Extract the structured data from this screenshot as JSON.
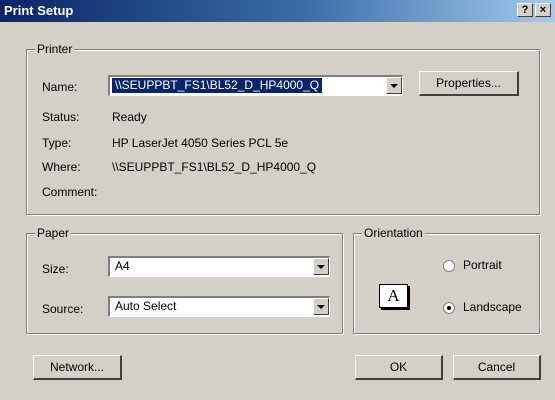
{
  "window": {
    "title": "Print Setup",
    "help_button": "?",
    "close_button": "×"
  },
  "printer": {
    "group_label": "Printer",
    "name_label": "Name:",
    "name_value": "\\\\SEUPPBT_FS1\\BL52_D_HP4000_Q",
    "properties_button": "Properties...",
    "status_label": "Status:",
    "status_value": "Ready",
    "type_label": "Type:",
    "type_value": "HP LaserJet 4050 Series PCL 5e",
    "where_label": "Where:",
    "where_value": "\\\\SEUPPBT_FS1\\BL52_D_HP4000_Q",
    "comment_label": "Comment:",
    "comment_value": ""
  },
  "paper": {
    "group_label": "Paper",
    "size_label": "Size:",
    "size_value": "A4",
    "source_label": "Source:",
    "source_value": "Auto Select"
  },
  "orientation": {
    "group_label": "Orientation",
    "icon_letter": "A",
    "portrait_label": "Portrait",
    "landscape_label": "Landscape",
    "selected": "Landscape"
  },
  "buttons": {
    "network": "Network...",
    "ok": "OK",
    "cancel": "Cancel"
  }
}
